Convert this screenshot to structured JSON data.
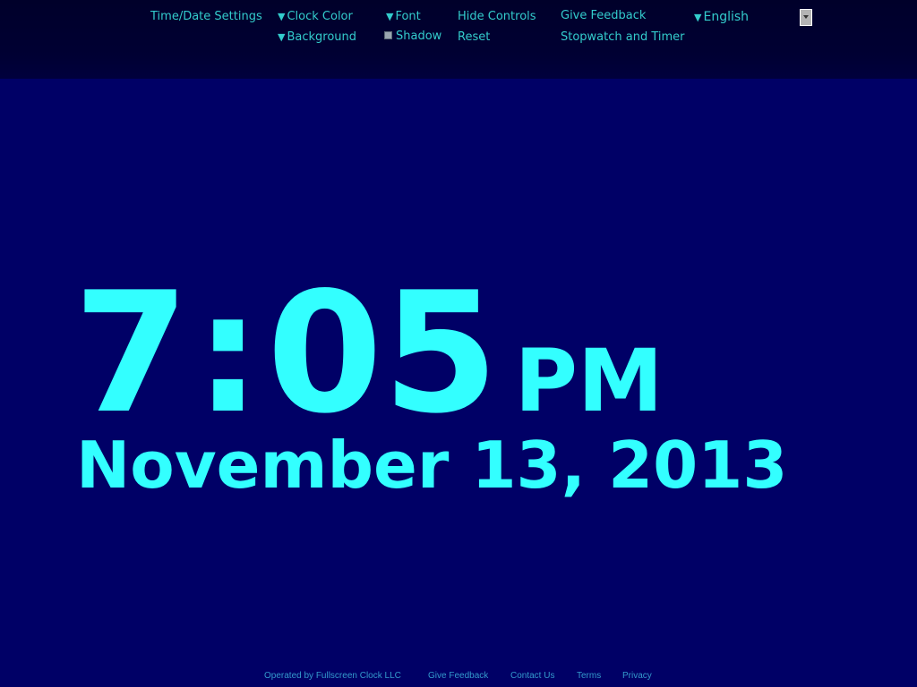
{
  "controls": {
    "time_date_settings": "Time/Date Settings",
    "clock_color": "Clock Color",
    "background": "Background",
    "font": "Font",
    "shadow": "Shadow",
    "hide_controls": "Hide Controls",
    "reset": "Reset",
    "give_feedback": "Give Feedback",
    "stopwatch_timer": "Stopwatch and Timer",
    "language": "English",
    "dropdown_marker": "▼"
  },
  "clock": {
    "hours": "7",
    "colon": ":",
    "minutes": "05",
    "ampm": "PM",
    "date": "November 13, 2013"
  },
  "footer": {
    "operated_by": "Operated by Fullscreen Clock LLC",
    "give_feedback": "Give Feedback",
    "contact_us": "Contact Us",
    "terms": "Terms",
    "privacy": "Privacy"
  },
  "colors": {
    "background": "#000066",
    "clock_text": "#33ffff",
    "control_text": "#33cccc",
    "footer_link": "#3399cc"
  }
}
